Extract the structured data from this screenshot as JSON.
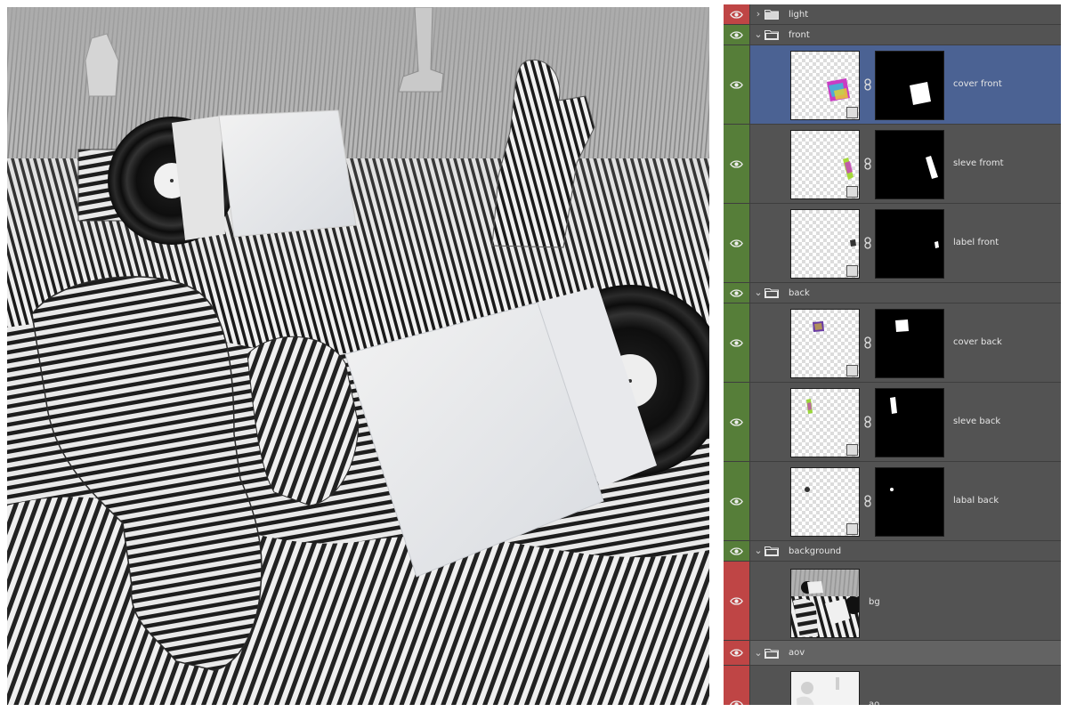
{
  "colors": {
    "panel_bg": "#535353",
    "selected_row": "#4b6293",
    "eye_green": "#567e39",
    "eye_red": "#bf4545",
    "group_aov_bg": "#636363"
  },
  "icons": {
    "visibility": "eye-icon",
    "folder": "folder-icon",
    "chevron_collapsed": "chevron-right-icon",
    "chevron_expanded": "chevron-down-icon",
    "mask_link": "chain-link-icon",
    "smart_object": "smart-object-icon"
  },
  "layers_panel": {
    "groups": [
      {
        "name": "light",
        "expanded": false,
        "eye_color": "red",
        "layers": []
      },
      {
        "name": "front",
        "expanded": true,
        "eye_color": "green",
        "layers": [
          {
            "name": "cover front",
            "selected": true,
            "has_mask": true
          },
          {
            "name": "sleve fromt",
            "selected": false,
            "has_mask": true
          },
          {
            "name": "label front",
            "selected": false,
            "has_mask": true
          }
        ]
      },
      {
        "name": "back",
        "expanded": true,
        "eye_color": "green",
        "layers": [
          {
            "name": "cover back",
            "selected": false,
            "has_mask": true
          },
          {
            "name": "sleve back",
            "selected": false,
            "has_mask": true
          },
          {
            "name": "labal back",
            "selected": false,
            "has_mask": true
          }
        ]
      },
      {
        "name": "background",
        "expanded": true,
        "eye_color": "red",
        "layers": [
          {
            "name": "bg",
            "selected": false,
            "has_mask": false
          }
        ]
      },
      {
        "name": "aov",
        "expanded": true,
        "eye_color": "red",
        "layers": [
          {
            "name": "ao",
            "selected": false,
            "has_mask": false
          }
        ]
      }
    ]
  }
}
